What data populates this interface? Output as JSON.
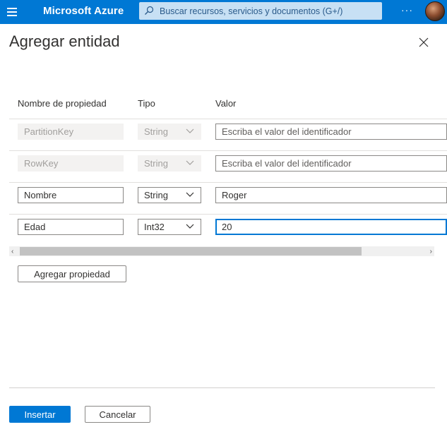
{
  "topbar": {
    "brand": "Microsoft Azure",
    "search_placeholder": "Buscar recursos, servicios y documentos (G+/)",
    "more_label": "···",
    "bg_color": "#0078d4"
  },
  "panel": {
    "title": "Agregar entidad"
  },
  "table": {
    "headers": {
      "property": "Nombre de propiedad",
      "type": "Tipo",
      "value": "Valor"
    },
    "rows": [
      {
        "name": "PartitionKey",
        "type": "String",
        "value": "",
        "value_placeholder": "Escriba el valor del identificador",
        "disabled": true
      },
      {
        "name": "RowKey",
        "type": "String",
        "value": "",
        "value_placeholder": "Escriba el valor del identificador",
        "disabled": true
      },
      {
        "name": "Nombre",
        "type": "String",
        "value": "Roger",
        "value_placeholder": "",
        "disabled": false
      },
      {
        "name": "Edad",
        "type": "Int32",
        "value": "20",
        "value_placeholder": "",
        "disabled": false
      }
    ]
  },
  "actions": {
    "add_property": "Agregar propiedad",
    "insert": "Insertar",
    "cancel": "Cancelar"
  },
  "icons": {
    "menu": "hamburger-menu-icon",
    "search": "search-icon",
    "close": "close-icon",
    "dropdown": "chevron-down-icon"
  },
  "colors": {
    "accent": "#0078d4",
    "disabled_bg": "#f3f2f1"
  }
}
